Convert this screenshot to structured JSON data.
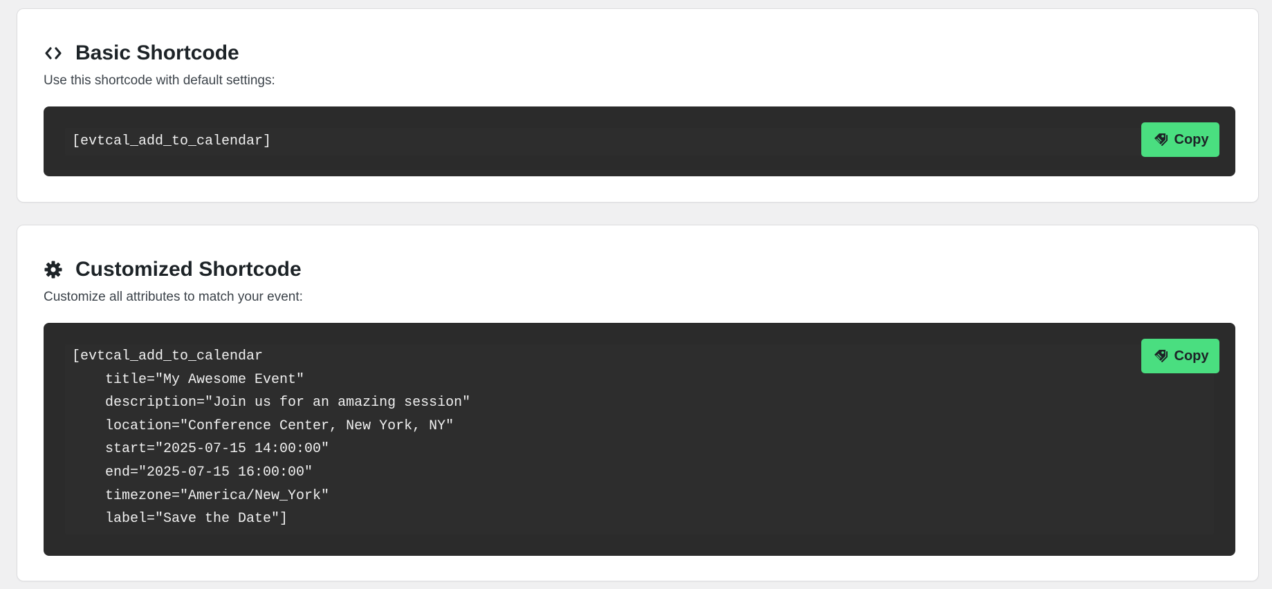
{
  "colors": {
    "page_background": "#f0f0f1",
    "card_background": "#ffffff",
    "code_background": "#2b2b2b",
    "code_text": "#f0f0f0",
    "copy_button": "#4ade80"
  },
  "basic": {
    "icon": "code-brackets-icon",
    "title": "Basic Shortcode",
    "description": "Use this shortcode with default settings:",
    "code": "[evtcal_add_to_calendar]",
    "copy_icon": "tags-icon",
    "copy_label": "Copy"
  },
  "customized": {
    "icon": "gear-icon",
    "title": "Customized Shortcode",
    "description": "Customize all attributes to match your event:",
    "code": "[evtcal_add_to_calendar\n    title=\"My Awesome Event\"\n    description=\"Join us for an amazing session\"\n    location=\"Conference Center, New York, NY\"\n    start=\"2025-07-15 14:00:00\"\n    end=\"2025-07-15 16:00:00\"\n    timezone=\"America/New_York\"\n    label=\"Save the Date\"]",
    "copy_icon": "tags-icon",
    "copy_label": "Copy"
  }
}
